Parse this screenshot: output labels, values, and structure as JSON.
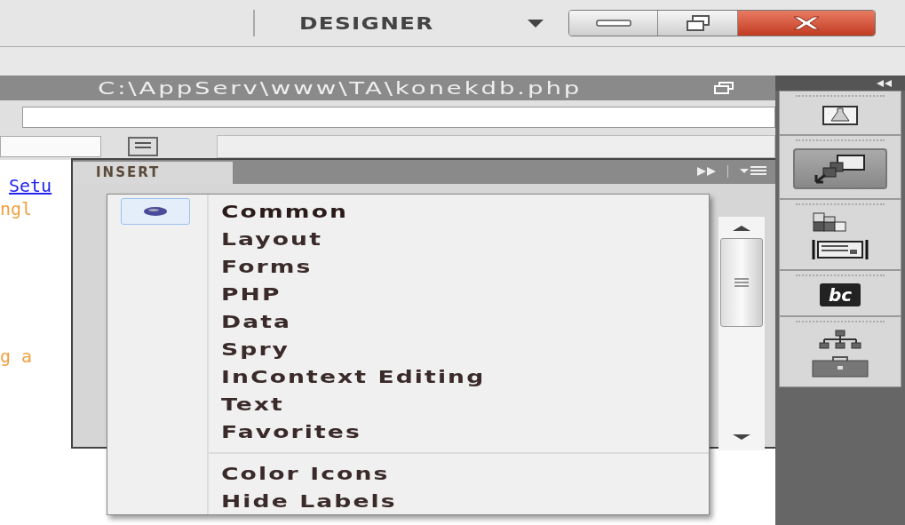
{
  "workspace": {
    "label": "DESIGNER"
  },
  "document": {
    "title": "C:\\AppServ\\www\\TA\\konekdb.php",
    "code_lines": [
      {
        "kind": "link",
        "text": "Setu"
      },
      {
        "kind": "string",
        "text": "ngl"
      },
      {
        "kind": "string",
        "text": "g a"
      }
    ]
  },
  "insert_panel": {
    "tab": "INSERT"
  },
  "menu": {
    "categories": [
      {
        "label": "Common",
        "selected": true
      },
      {
        "label": "Layout",
        "selected": false
      },
      {
        "label": "Forms",
        "selected": false
      },
      {
        "label": "PHP",
        "selected": false
      },
      {
        "label": "Data",
        "selected": false
      },
      {
        "label": "Spry",
        "selected": false
      },
      {
        "label": "InContext Editing",
        "selected": false
      },
      {
        "label": "Text",
        "selected": false
      },
      {
        "label": "Favorites",
        "selected": false
      }
    ],
    "options": [
      {
        "label": "Color Icons"
      },
      {
        "label": "Hide Labels"
      }
    ]
  },
  "dock": {
    "sections": [
      {
        "items": [
          {
            "kind": "flask",
            "selected": false
          }
        ]
      },
      {
        "items": [
          {
            "kind": "panels",
            "selected": true
          }
        ]
      },
      {
        "items": [
          {
            "kind": "blocks",
            "selected": false
          },
          {
            "kind": "frame",
            "selected": false
          }
        ]
      },
      {
        "items": [
          {
            "kind": "badge",
            "label": "bc",
            "selected": false
          }
        ]
      },
      {
        "items": [
          {
            "kind": "tree",
            "selected": false
          },
          {
            "kind": "case",
            "selected": false
          }
        ]
      }
    ]
  }
}
